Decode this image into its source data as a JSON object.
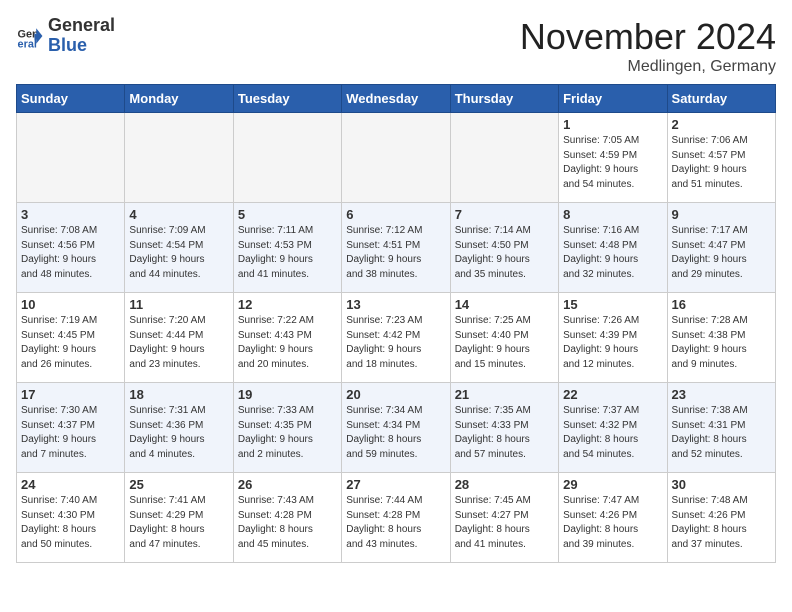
{
  "header": {
    "logo_general": "General",
    "logo_blue": "Blue",
    "title": "November 2024",
    "subtitle": "Medlingen, Germany"
  },
  "days_of_week": [
    "Sunday",
    "Monday",
    "Tuesday",
    "Wednesday",
    "Thursday",
    "Friday",
    "Saturday"
  ],
  "weeks": [
    [
      {
        "day": "",
        "info": ""
      },
      {
        "day": "",
        "info": ""
      },
      {
        "day": "",
        "info": ""
      },
      {
        "day": "",
        "info": ""
      },
      {
        "day": "",
        "info": ""
      },
      {
        "day": "1",
        "info": "Sunrise: 7:05 AM\nSunset: 4:59 PM\nDaylight: 9 hours\nand 54 minutes."
      },
      {
        "day": "2",
        "info": "Sunrise: 7:06 AM\nSunset: 4:57 PM\nDaylight: 9 hours\nand 51 minutes."
      }
    ],
    [
      {
        "day": "3",
        "info": "Sunrise: 7:08 AM\nSunset: 4:56 PM\nDaylight: 9 hours\nand 48 minutes."
      },
      {
        "day": "4",
        "info": "Sunrise: 7:09 AM\nSunset: 4:54 PM\nDaylight: 9 hours\nand 44 minutes."
      },
      {
        "day": "5",
        "info": "Sunrise: 7:11 AM\nSunset: 4:53 PM\nDaylight: 9 hours\nand 41 minutes."
      },
      {
        "day": "6",
        "info": "Sunrise: 7:12 AM\nSunset: 4:51 PM\nDaylight: 9 hours\nand 38 minutes."
      },
      {
        "day": "7",
        "info": "Sunrise: 7:14 AM\nSunset: 4:50 PM\nDaylight: 9 hours\nand 35 minutes."
      },
      {
        "day": "8",
        "info": "Sunrise: 7:16 AM\nSunset: 4:48 PM\nDaylight: 9 hours\nand 32 minutes."
      },
      {
        "day": "9",
        "info": "Sunrise: 7:17 AM\nSunset: 4:47 PM\nDaylight: 9 hours\nand 29 minutes."
      }
    ],
    [
      {
        "day": "10",
        "info": "Sunrise: 7:19 AM\nSunset: 4:45 PM\nDaylight: 9 hours\nand 26 minutes."
      },
      {
        "day": "11",
        "info": "Sunrise: 7:20 AM\nSunset: 4:44 PM\nDaylight: 9 hours\nand 23 minutes."
      },
      {
        "day": "12",
        "info": "Sunrise: 7:22 AM\nSunset: 4:43 PM\nDaylight: 9 hours\nand 20 minutes."
      },
      {
        "day": "13",
        "info": "Sunrise: 7:23 AM\nSunset: 4:42 PM\nDaylight: 9 hours\nand 18 minutes."
      },
      {
        "day": "14",
        "info": "Sunrise: 7:25 AM\nSunset: 4:40 PM\nDaylight: 9 hours\nand 15 minutes."
      },
      {
        "day": "15",
        "info": "Sunrise: 7:26 AM\nSunset: 4:39 PM\nDaylight: 9 hours\nand 12 minutes."
      },
      {
        "day": "16",
        "info": "Sunrise: 7:28 AM\nSunset: 4:38 PM\nDaylight: 9 hours\nand 9 minutes."
      }
    ],
    [
      {
        "day": "17",
        "info": "Sunrise: 7:30 AM\nSunset: 4:37 PM\nDaylight: 9 hours\nand 7 minutes."
      },
      {
        "day": "18",
        "info": "Sunrise: 7:31 AM\nSunset: 4:36 PM\nDaylight: 9 hours\nand 4 minutes."
      },
      {
        "day": "19",
        "info": "Sunrise: 7:33 AM\nSunset: 4:35 PM\nDaylight: 9 hours\nand 2 minutes."
      },
      {
        "day": "20",
        "info": "Sunrise: 7:34 AM\nSunset: 4:34 PM\nDaylight: 8 hours\nand 59 minutes."
      },
      {
        "day": "21",
        "info": "Sunrise: 7:35 AM\nSunset: 4:33 PM\nDaylight: 8 hours\nand 57 minutes."
      },
      {
        "day": "22",
        "info": "Sunrise: 7:37 AM\nSunset: 4:32 PM\nDaylight: 8 hours\nand 54 minutes."
      },
      {
        "day": "23",
        "info": "Sunrise: 7:38 AM\nSunset: 4:31 PM\nDaylight: 8 hours\nand 52 minutes."
      }
    ],
    [
      {
        "day": "24",
        "info": "Sunrise: 7:40 AM\nSunset: 4:30 PM\nDaylight: 8 hours\nand 50 minutes."
      },
      {
        "day": "25",
        "info": "Sunrise: 7:41 AM\nSunset: 4:29 PM\nDaylight: 8 hours\nand 47 minutes."
      },
      {
        "day": "26",
        "info": "Sunrise: 7:43 AM\nSunset: 4:28 PM\nDaylight: 8 hours\nand 45 minutes."
      },
      {
        "day": "27",
        "info": "Sunrise: 7:44 AM\nSunset: 4:28 PM\nDaylight: 8 hours\nand 43 minutes."
      },
      {
        "day": "28",
        "info": "Sunrise: 7:45 AM\nSunset: 4:27 PM\nDaylight: 8 hours\nand 41 minutes."
      },
      {
        "day": "29",
        "info": "Sunrise: 7:47 AM\nSunset: 4:26 PM\nDaylight: 8 hours\nand 39 minutes."
      },
      {
        "day": "30",
        "info": "Sunrise: 7:48 AM\nSunset: 4:26 PM\nDaylight: 8 hours\nand 37 minutes."
      }
    ]
  ]
}
